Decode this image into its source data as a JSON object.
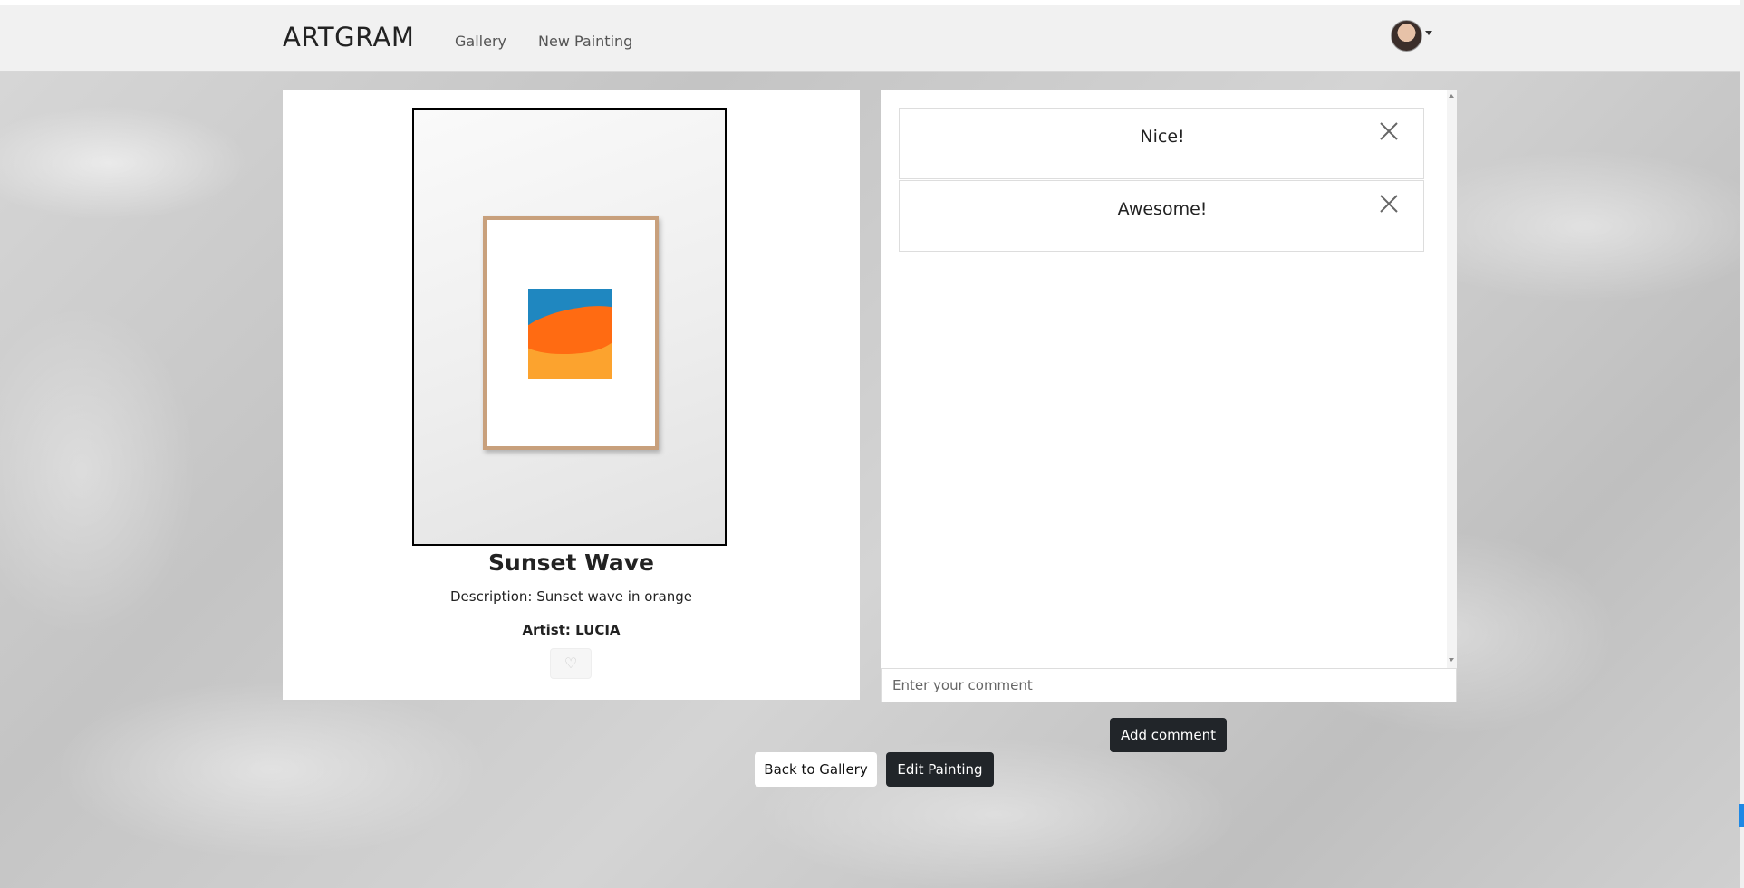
{
  "navbar": {
    "brand": "ARTGRAM",
    "links": [
      {
        "label": "Gallery"
      },
      {
        "label": "New Painting"
      }
    ]
  },
  "painting": {
    "title": "Sunset Wave",
    "description_label": "Description:",
    "description": "Sunset wave in orange",
    "artist_label": "Artist:",
    "artist": "LUCIA",
    "like_icon": "heart-icon"
  },
  "comments": {
    "items": [
      {
        "text": "Nice!"
      },
      {
        "text": "Awesome!"
      }
    ],
    "input_placeholder": "Enter your comment",
    "add_button": "Add comment"
  },
  "actions": {
    "back_label": "Back to Gallery",
    "edit_label": "Edit Painting"
  },
  "colors": {
    "dark_button": "#212529",
    "navbar_bg": "#f1f1f1",
    "art_blue": "#1f87c0",
    "art_orange": "#ff6b12",
    "art_light_orange": "#fca32e"
  }
}
